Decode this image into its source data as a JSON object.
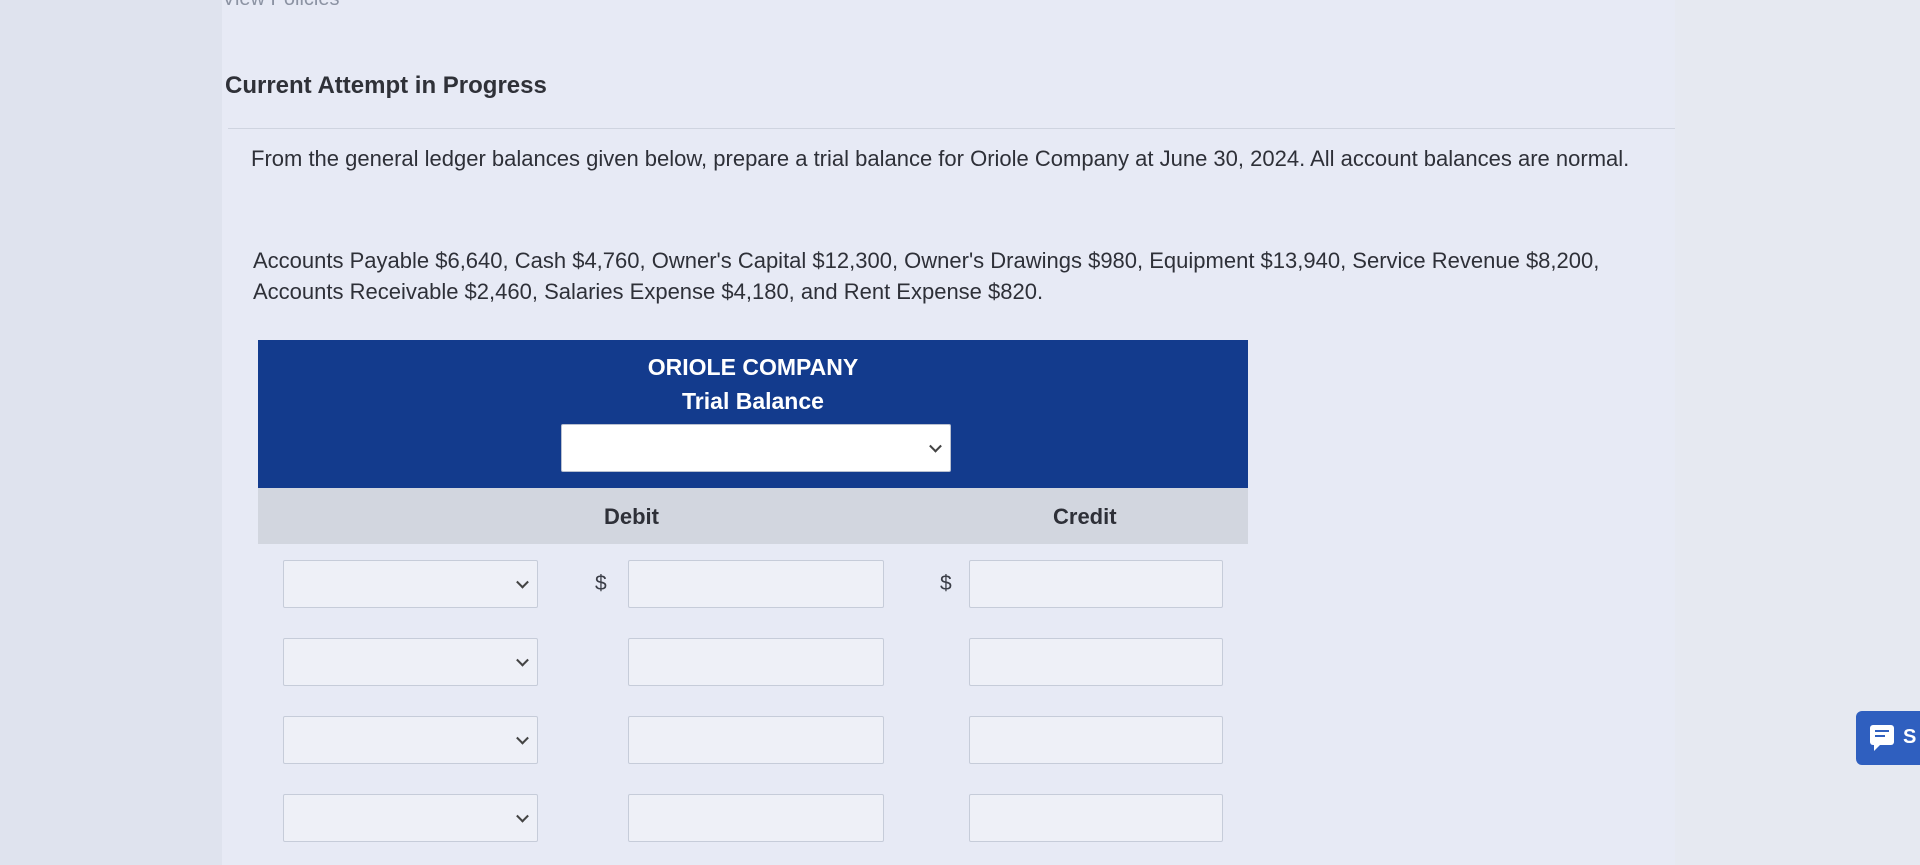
{
  "header": {
    "view_policies": "View Policies",
    "attempt_status": "Current Attempt in Progress"
  },
  "problem": {
    "instructions": "From the general ledger balances given below, prepare a trial balance for Oriole Company at June 30, 2024. All account balances are normal.",
    "balances": "Accounts Payable $6,640, Cash $4,760, Owner's Capital $12,300, Owner's Drawings $980, Equipment $13,940, Service Revenue $8,200, Accounts Receivable $2,460, Salaries Expense $4,180, and Rent Expense $820."
  },
  "trial_balance": {
    "company": "ORIOLE COMPANY",
    "title": "Trial Balance",
    "date_select_value": "",
    "debit_header": "Debit",
    "credit_header": "Credit",
    "currency_symbol": "$",
    "rows": [
      {
        "account": "",
        "debit": "",
        "credit": ""
      },
      {
        "account": "",
        "debit": "",
        "credit": ""
      },
      {
        "account": "",
        "debit": "",
        "credit": ""
      },
      {
        "account": "",
        "debit": "",
        "credit": ""
      }
    ]
  },
  "chat": {
    "label": "S",
    "icon": "chat-icon"
  },
  "colors": {
    "header_blue": "#133b8d",
    "column_header_gray": "#d2d6df",
    "page_bg": "#e7eaf5",
    "chat_blue": "#2f5fbf"
  }
}
